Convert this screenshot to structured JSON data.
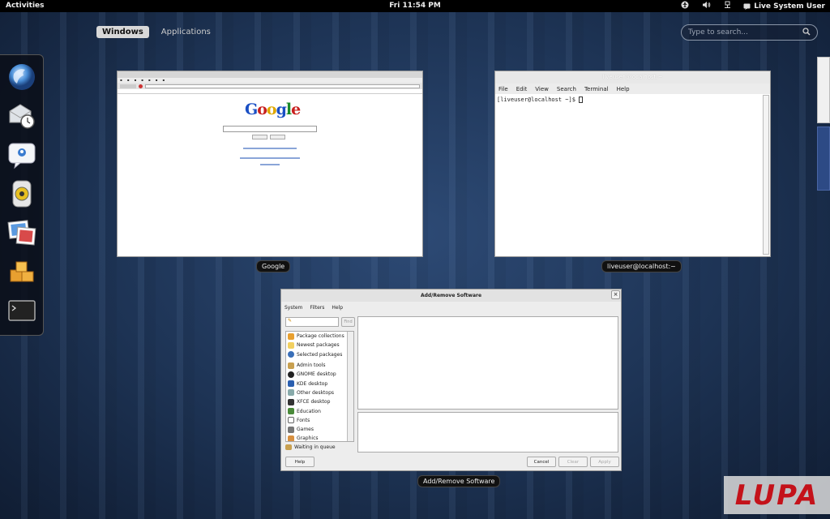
{
  "topbar": {
    "activities": "Activities",
    "clock": "Fri 11:54 PM",
    "user": "Live System User"
  },
  "overview": {
    "tabs": [
      {
        "label": "Windows",
        "active": true
      },
      {
        "label": "Applications",
        "active": false
      }
    ],
    "search_placeholder": "Type to search..."
  },
  "dash": {
    "items": [
      "firefox-icon",
      "evolution-mail-icon",
      "empathy-chat-icon",
      "rhythmbox-icon",
      "shotwell-photos-icon",
      "files-icon",
      "terminal-icon"
    ]
  },
  "windows": {
    "firefox": {
      "caption": "Google",
      "logo": "Google"
    },
    "terminal": {
      "caption": "liveuser@localhost:~",
      "title": "liveuser@localhost:~",
      "menu": [
        "File",
        "Edit",
        "View",
        "Search",
        "Terminal",
        "Help"
      ],
      "prompt": "[liveuser@localhost ~]$ "
    },
    "software": {
      "caption": "Add/Remove Software",
      "title": "Add/Remove Software",
      "menu": [
        "System",
        "Filters",
        "Help"
      ],
      "find": "Find",
      "groups": [
        "Package collections",
        "Newest packages",
        "Selected packages",
        "Admin tools",
        "GNOME desktop",
        "KDE desktop",
        "Other desktops",
        "XFCE desktop",
        "Education",
        "Fonts",
        "Games",
        "Graphics"
      ],
      "status": "Waiting in queue",
      "buttons": {
        "help": "Help",
        "cancel": "Cancel",
        "clear": "Clear",
        "apply": "Apply"
      }
    }
  },
  "watermark": "LUPA"
}
